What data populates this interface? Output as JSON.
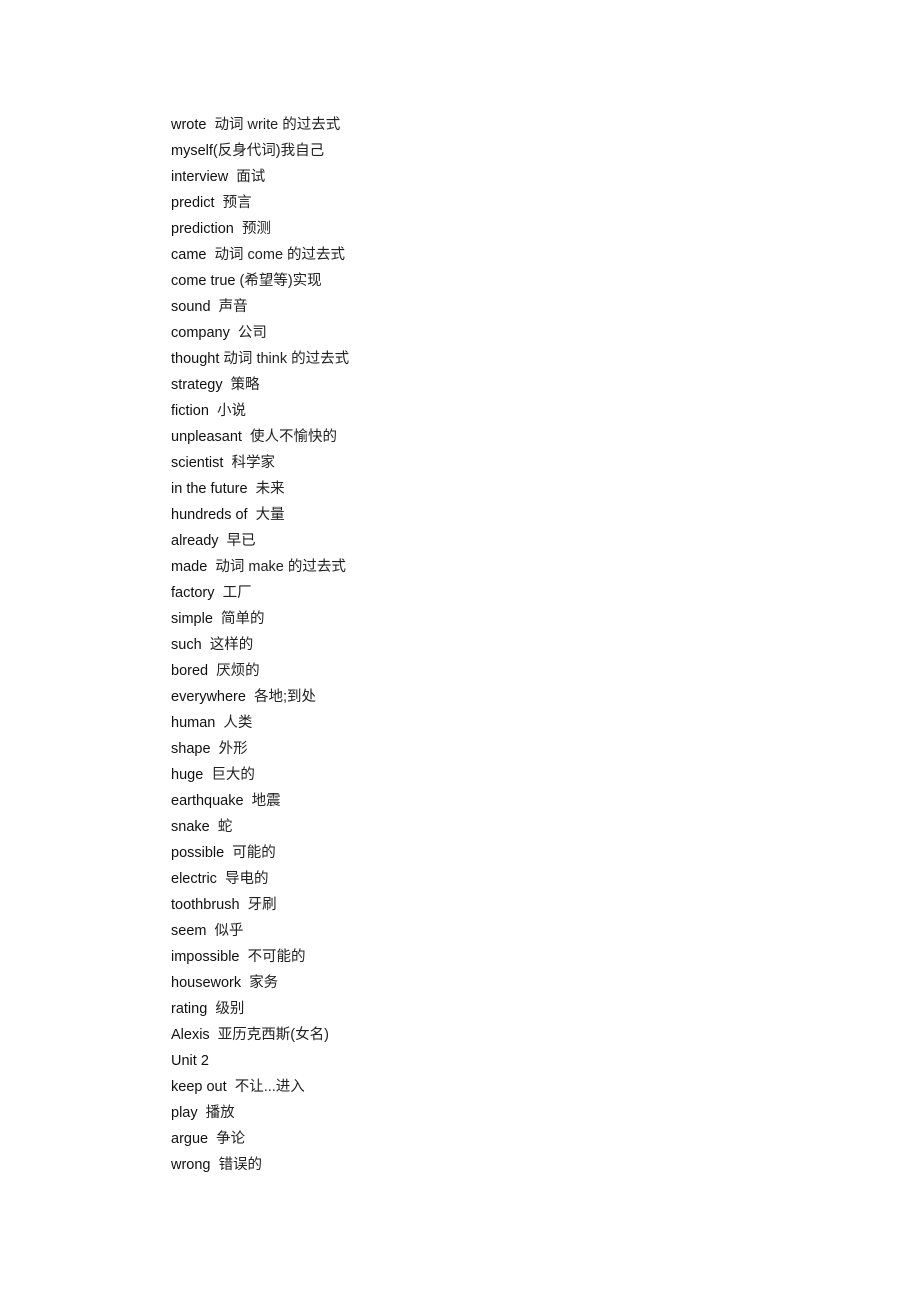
{
  "document": {
    "entries": [
      {
        "term": "wrote",
        "sep": "  ",
        "meaning": "动词 write 的过去式"
      },
      {
        "term": "myself",
        "sep": "",
        "meaning": "(反身代词)我自己"
      },
      {
        "term": "interview",
        "sep": "  ",
        "meaning": "面试"
      },
      {
        "term": "predict",
        "sep": "  ",
        "meaning": "预言"
      },
      {
        "term": "prediction",
        "sep": "  ",
        "meaning": "预测"
      },
      {
        "term": "came",
        "sep": "  ",
        "meaning": "动词 come 的过去式"
      },
      {
        "term": "come true",
        "sep": " ",
        "meaning": "(希望等)实现"
      },
      {
        "term": "sound",
        "sep": "  ",
        "meaning": "声音"
      },
      {
        "term": "company",
        "sep": "  ",
        "meaning": "公司"
      },
      {
        "term": "thought",
        "sep": " ",
        "meaning": "动词 think 的过去式"
      },
      {
        "term": "strategy",
        "sep": "  ",
        "meaning": "策略"
      },
      {
        "term": "fiction",
        "sep": "  ",
        "meaning": "小说"
      },
      {
        "term": "unpleasant",
        "sep": "  ",
        "meaning": "使人不愉快的"
      },
      {
        "term": "scientist",
        "sep": "  ",
        "meaning": "科学家"
      },
      {
        "term": "in the future",
        "sep": "  ",
        "meaning": "未来"
      },
      {
        "term": "hundreds of",
        "sep": "  ",
        "meaning": "大量"
      },
      {
        "term": "already",
        "sep": "  ",
        "meaning": "早已"
      },
      {
        "term": "made",
        "sep": "  ",
        "meaning": "动词 make 的过去式"
      },
      {
        "term": "factory",
        "sep": "  ",
        "meaning": "工厂"
      },
      {
        "term": "simple",
        "sep": "  ",
        "meaning": "简单的"
      },
      {
        "term": "such",
        "sep": "  ",
        "meaning": "这样的"
      },
      {
        "term": "bored",
        "sep": "  ",
        "meaning": "厌烦的"
      },
      {
        "term": "everywhere",
        "sep": "  ",
        "meaning": "各地;到处"
      },
      {
        "term": "human",
        "sep": "  ",
        "meaning": "人类"
      },
      {
        "term": "shape",
        "sep": "  ",
        "meaning": "外形"
      },
      {
        "term": "huge",
        "sep": "  ",
        "meaning": "巨大的"
      },
      {
        "term": "earthquake",
        "sep": "  ",
        "meaning": "地震"
      },
      {
        "term": "snake",
        "sep": "  ",
        "meaning": "蛇"
      },
      {
        "term": "possible",
        "sep": "  ",
        "meaning": "可能的"
      },
      {
        "term": "electric",
        "sep": "  ",
        "meaning": "导电的"
      },
      {
        "term": "toothbrush",
        "sep": "  ",
        "meaning": "牙刷"
      },
      {
        "term": "seem",
        "sep": "  ",
        "meaning": "似乎"
      },
      {
        "term": "impossible",
        "sep": "  ",
        "meaning": "不可能的"
      },
      {
        "term": "housework",
        "sep": "  ",
        "meaning": "家务"
      },
      {
        "term": "rating",
        "sep": "  ",
        "meaning": "级别"
      },
      {
        "term": "Alexis",
        "sep": "  ",
        "meaning": "亚历克西斯(女名)"
      },
      {
        "term": "Unit 2",
        "sep": "",
        "meaning": ""
      },
      {
        "term": "keep out",
        "sep": "  ",
        "meaning": "不让...进入"
      },
      {
        "term": "play",
        "sep": "  ",
        "meaning": "播放"
      },
      {
        "term": "argue",
        "sep": "  ",
        "meaning": "争论"
      },
      {
        "term": "wrong",
        "sep": "  ",
        "meaning": "错误的"
      }
    ]
  }
}
